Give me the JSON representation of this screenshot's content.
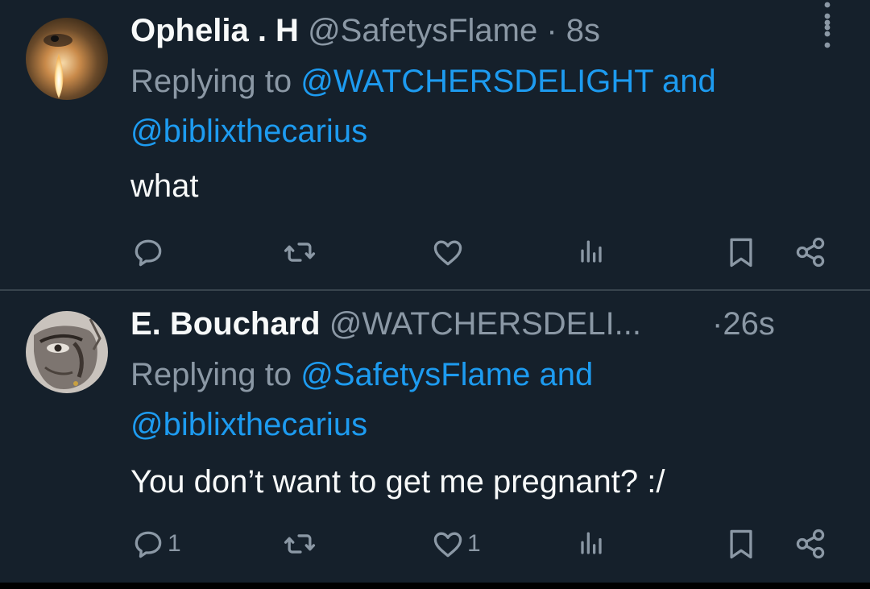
{
  "tweets": [
    {
      "name": "Ophelia . H",
      "handle": "@SafetysFlame",
      "separator": "·",
      "time": "8s",
      "replying_prefix": "Replying to ",
      "reply_link_1": "@WATCHERSDELIGHT",
      "reply_joiner": " and",
      "reply_link_2": "@biblixthecarius",
      "text": "what",
      "counts": {
        "reply": "",
        "retweet": "",
        "like": ""
      }
    },
    {
      "name": "E. Bouchard",
      "handle": "@WATCHERSDELI...",
      "separator": "·",
      "time": "26s",
      "replying_prefix": "Replying to ",
      "reply_link_1": "@SafetysFlame",
      "reply_joiner": " and",
      "reply_link_2": "@biblixthecarius",
      "text": "You don’t want to get me pregnant? :/",
      "counts": {
        "reply": "1",
        "retweet": "",
        "like": "1"
      }
    }
  ],
  "colors": {
    "background": "#15202b",
    "link": "#1d9bf0",
    "muted": "#8b98a5",
    "text": "#f7f9f9",
    "divider": "#38444d"
  },
  "icons": [
    "reply-icon",
    "retweet-icon",
    "like-icon",
    "views-icon",
    "bookmark-icon",
    "share-icon",
    "more-icon"
  ]
}
